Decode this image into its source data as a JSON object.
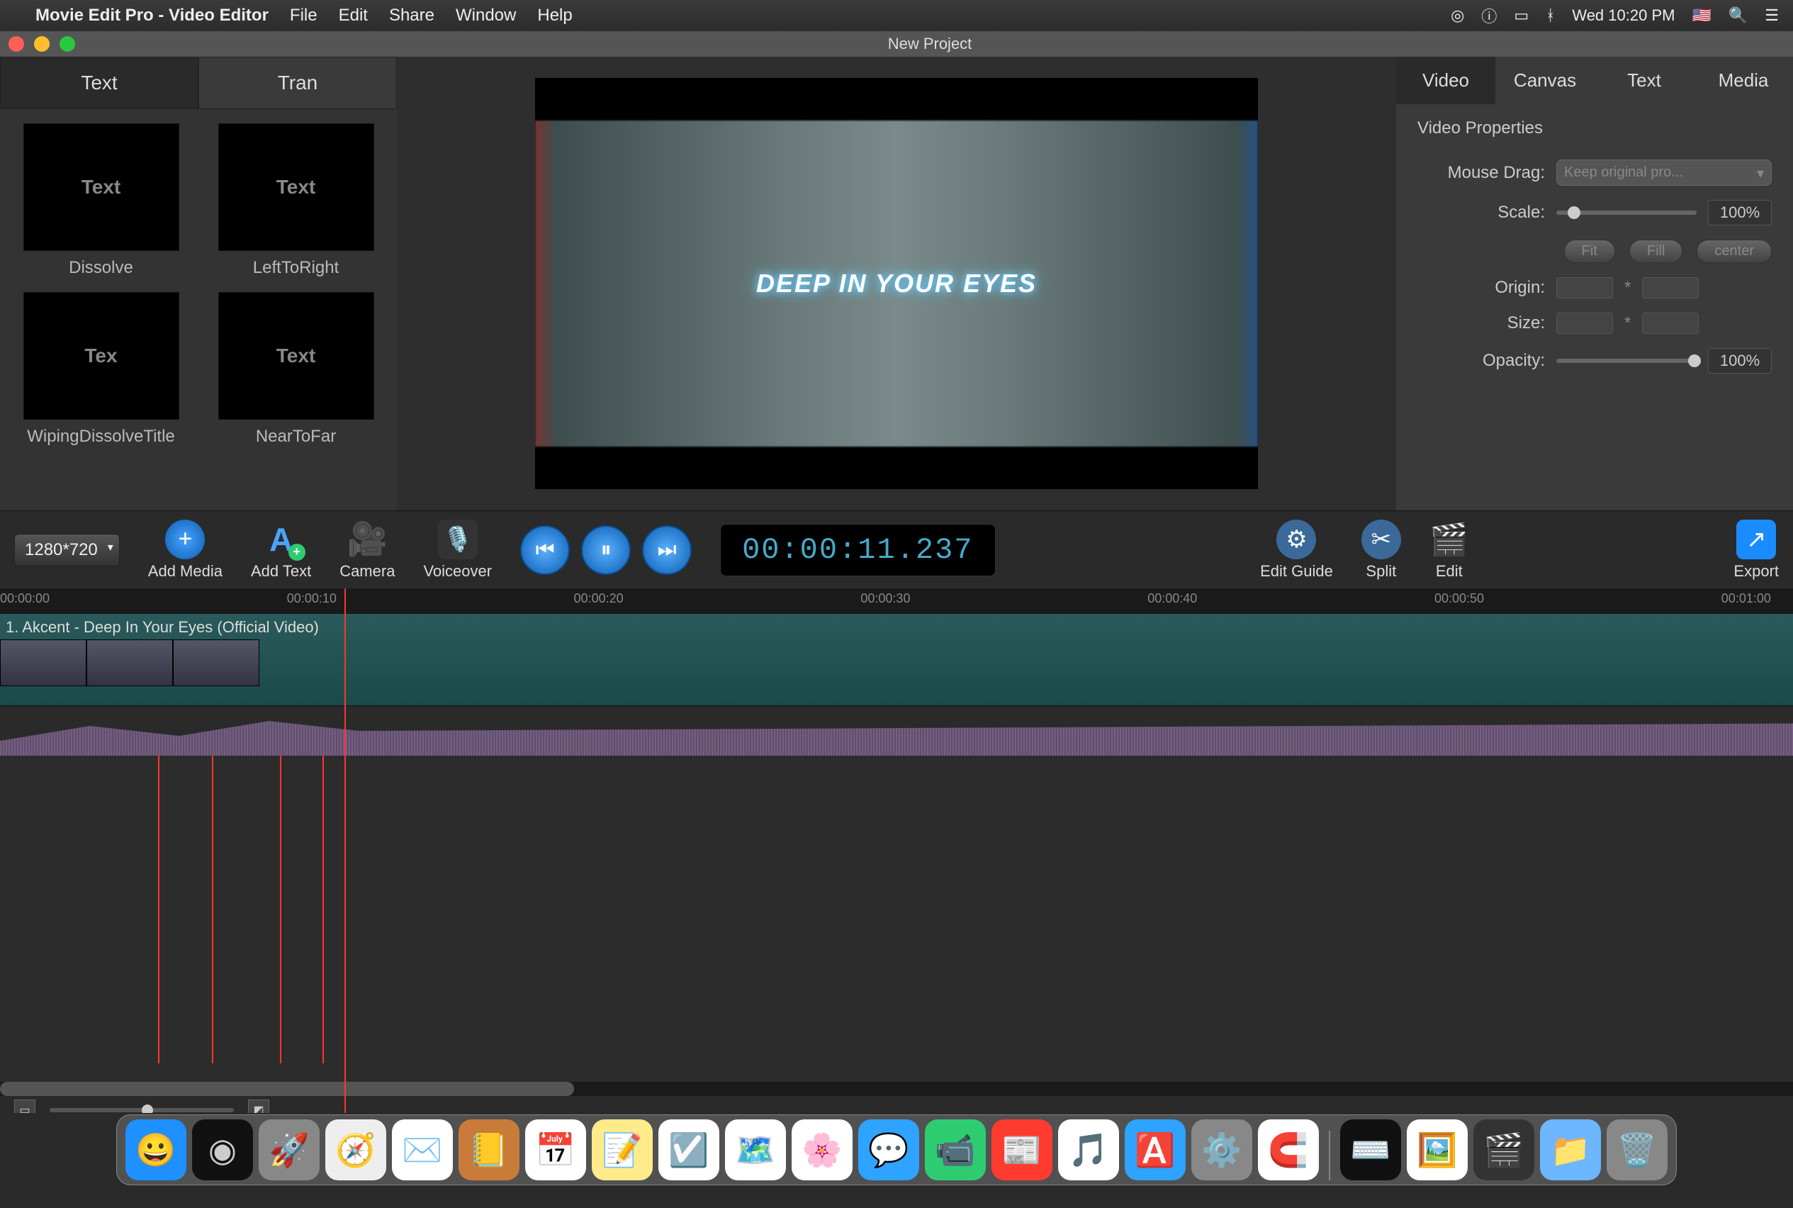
{
  "menubar": {
    "app_name": "Movie Edit Pro - Video Editor",
    "items": [
      "File",
      "Edit",
      "Share",
      "Window",
      "Help"
    ],
    "clock": "Wed 10:20 PM"
  },
  "window": {
    "title": "New Project"
  },
  "left_panel": {
    "tabs": [
      "Text",
      "Tran"
    ],
    "active_tab": 0,
    "presets": [
      {
        "thumb_text": "Text",
        "label": "Dissolve"
      },
      {
        "thumb_text": "Text",
        "label": "LeftToRight"
      },
      {
        "thumb_text": "Tex",
        "label": "WipingDissolveTitle"
      },
      {
        "thumb_text": "Text",
        "label": "NearToFar"
      }
    ]
  },
  "preview": {
    "overlay_text": "DEEP IN YOUR EYES"
  },
  "right_panel": {
    "tabs": [
      "Video",
      "Canvas",
      "Text",
      "Media"
    ],
    "active_tab": 0,
    "heading": "Video Properties",
    "mouse_drag_label": "Mouse Drag:",
    "mouse_drag_value": "Keep original pro...",
    "scale_label": "Scale:",
    "scale_value": "100%",
    "fit_buttons": [
      "Fit",
      "Fill",
      "center"
    ],
    "origin_label": "Origin:",
    "size_label": "Size:",
    "star": "*",
    "opacity_label": "Opacity:",
    "opacity_value": "100%"
  },
  "toolbar": {
    "resolution": "1280*720",
    "add_media": "Add Media",
    "add_text": "Add Text",
    "camera": "Camera",
    "voiceover": "Voiceover",
    "timecode": "00:00:11.237",
    "edit_guide": "Edit Guide",
    "split": "Split",
    "edit": "Edit",
    "export": "Export"
  },
  "timeline": {
    "ticks": [
      "00:00:00",
      "00:00:10",
      "00:00:20",
      "00:00:30",
      "00:00:40",
      "00:00:50",
      "00:01:00"
    ],
    "track_label": "1. Akcent - Deep In Your Eyes (Official Video)",
    "playhead_pct": 19.2,
    "markers_pct": [
      8.8,
      11.8,
      15.6,
      18.0
    ]
  },
  "dock": {
    "apps": [
      {
        "name": "finder",
        "color": "#1e90ff",
        "glyph": "😀"
      },
      {
        "name": "siri",
        "color": "#111",
        "glyph": "◉"
      },
      {
        "name": "launchpad",
        "color": "#888",
        "glyph": "🚀"
      },
      {
        "name": "safari",
        "color": "#eee",
        "glyph": "🧭"
      },
      {
        "name": "mail",
        "color": "#fff",
        "glyph": "✉️"
      },
      {
        "name": "contacts",
        "color": "#c97b3a",
        "glyph": "📒"
      },
      {
        "name": "calendar",
        "color": "#fff",
        "glyph": "📅"
      },
      {
        "name": "notes",
        "color": "#ffeb8a",
        "glyph": "📝"
      },
      {
        "name": "reminders",
        "color": "#fff",
        "glyph": "☑️"
      },
      {
        "name": "maps",
        "color": "#fff",
        "glyph": "🗺️"
      },
      {
        "name": "photos",
        "color": "#fff",
        "glyph": "🌸"
      },
      {
        "name": "messages",
        "color": "#2ea3ff",
        "glyph": "💬"
      },
      {
        "name": "facetime",
        "color": "#2ecc71",
        "glyph": "📹"
      },
      {
        "name": "news",
        "color": "#ff3b30",
        "glyph": "📰"
      },
      {
        "name": "itunes",
        "color": "#fff",
        "glyph": "🎵"
      },
      {
        "name": "appstore",
        "color": "#2ea3ff",
        "glyph": "🅰️"
      },
      {
        "name": "settings",
        "color": "#888",
        "glyph": "⚙️"
      },
      {
        "name": "magnet",
        "color": "#fff",
        "glyph": "🧲"
      }
    ],
    "right_apps": [
      {
        "name": "terminal",
        "color": "#111",
        "glyph": "⌨️"
      },
      {
        "name": "preview",
        "color": "#fff",
        "glyph": "🖼️"
      },
      {
        "name": "imovie",
        "color": "#333",
        "glyph": "🎬"
      },
      {
        "name": "folder",
        "color": "#6cb7ff",
        "glyph": "📁"
      },
      {
        "name": "trash",
        "color": "#888",
        "glyph": "🗑️"
      }
    ]
  }
}
